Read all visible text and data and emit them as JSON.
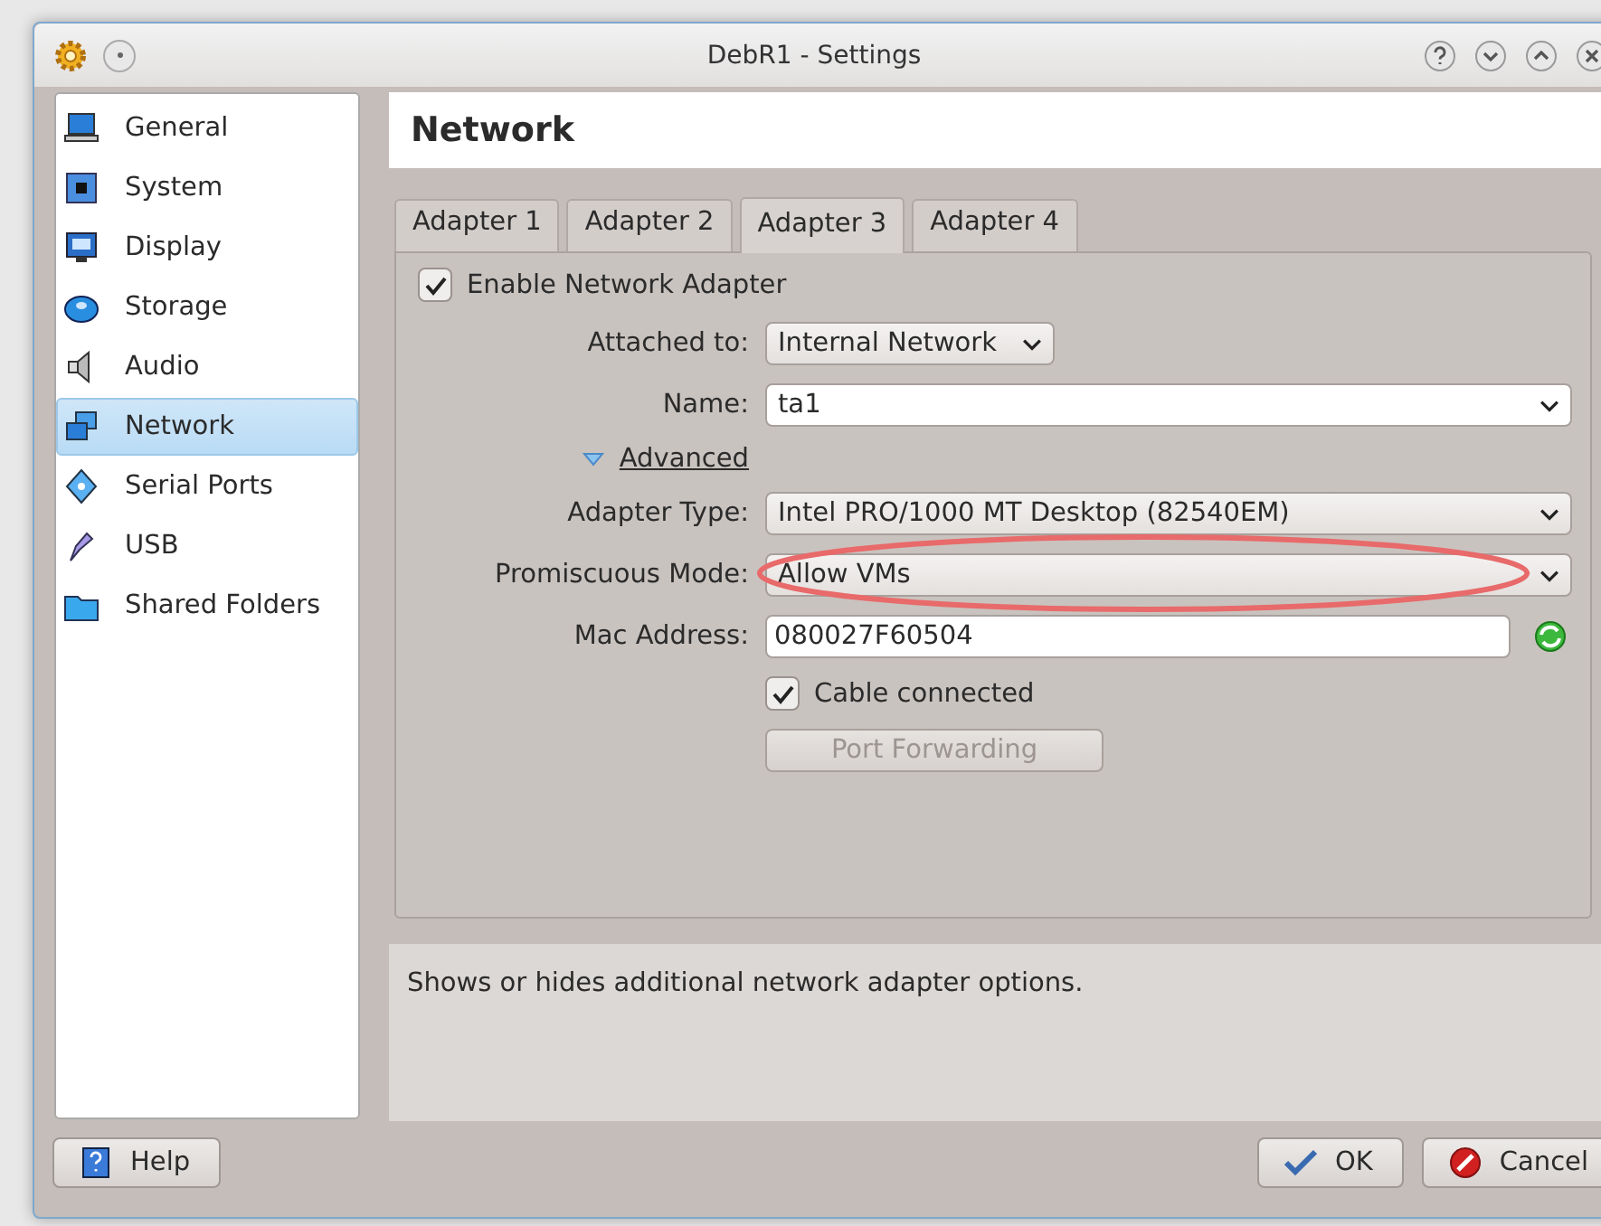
{
  "window": {
    "title": "DebR1 - Settings"
  },
  "sidebar": {
    "items": [
      {
        "label": "General",
        "selected": false
      },
      {
        "label": "System",
        "selected": false
      },
      {
        "label": "Display",
        "selected": false
      },
      {
        "label": "Storage",
        "selected": false
      },
      {
        "label": "Audio",
        "selected": false
      },
      {
        "label": "Network",
        "selected": true
      },
      {
        "label": "Serial Ports",
        "selected": false
      },
      {
        "label": "USB",
        "selected": false
      },
      {
        "label": "Shared Folders",
        "selected": false
      }
    ]
  },
  "page_title": "Network",
  "tabs": [
    {
      "label": "Adapter 1",
      "selected": false
    },
    {
      "label": "Adapter 2",
      "selected": false
    },
    {
      "label": "Adapter 3",
      "selected": true
    },
    {
      "label": "Adapter 4",
      "selected": false
    }
  ],
  "enable_adapter": {
    "label": "Enable Network Adapter",
    "checked": true
  },
  "attached_to": {
    "label": "Attached to:",
    "value": "Internal Network"
  },
  "name": {
    "label": "Name:",
    "value": "ta1"
  },
  "advanced": {
    "label": "Advanced",
    "expanded": true
  },
  "adapter_type": {
    "label": "Adapter Type:",
    "value": "Intel PRO/1000 MT Desktop (82540EM)"
  },
  "promiscuous_mode": {
    "label": "Promiscuous Mode:",
    "value": "Allow VMs",
    "highlighted": true
  },
  "mac_address": {
    "label": "Mac Address:",
    "value": "080027F60504"
  },
  "cable_connected": {
    "label": "Cable connected",
    "checked": true
  },
  "port_forwarding": {
    "label": "Port Forwarding",
    "disabled": true
  },
  "description": "Shows or hides additional network adapter options.",
  "buttons": {
    "help": "Help",
    "ok": "OK",
    "cancel": "Cancel"
  }
}
